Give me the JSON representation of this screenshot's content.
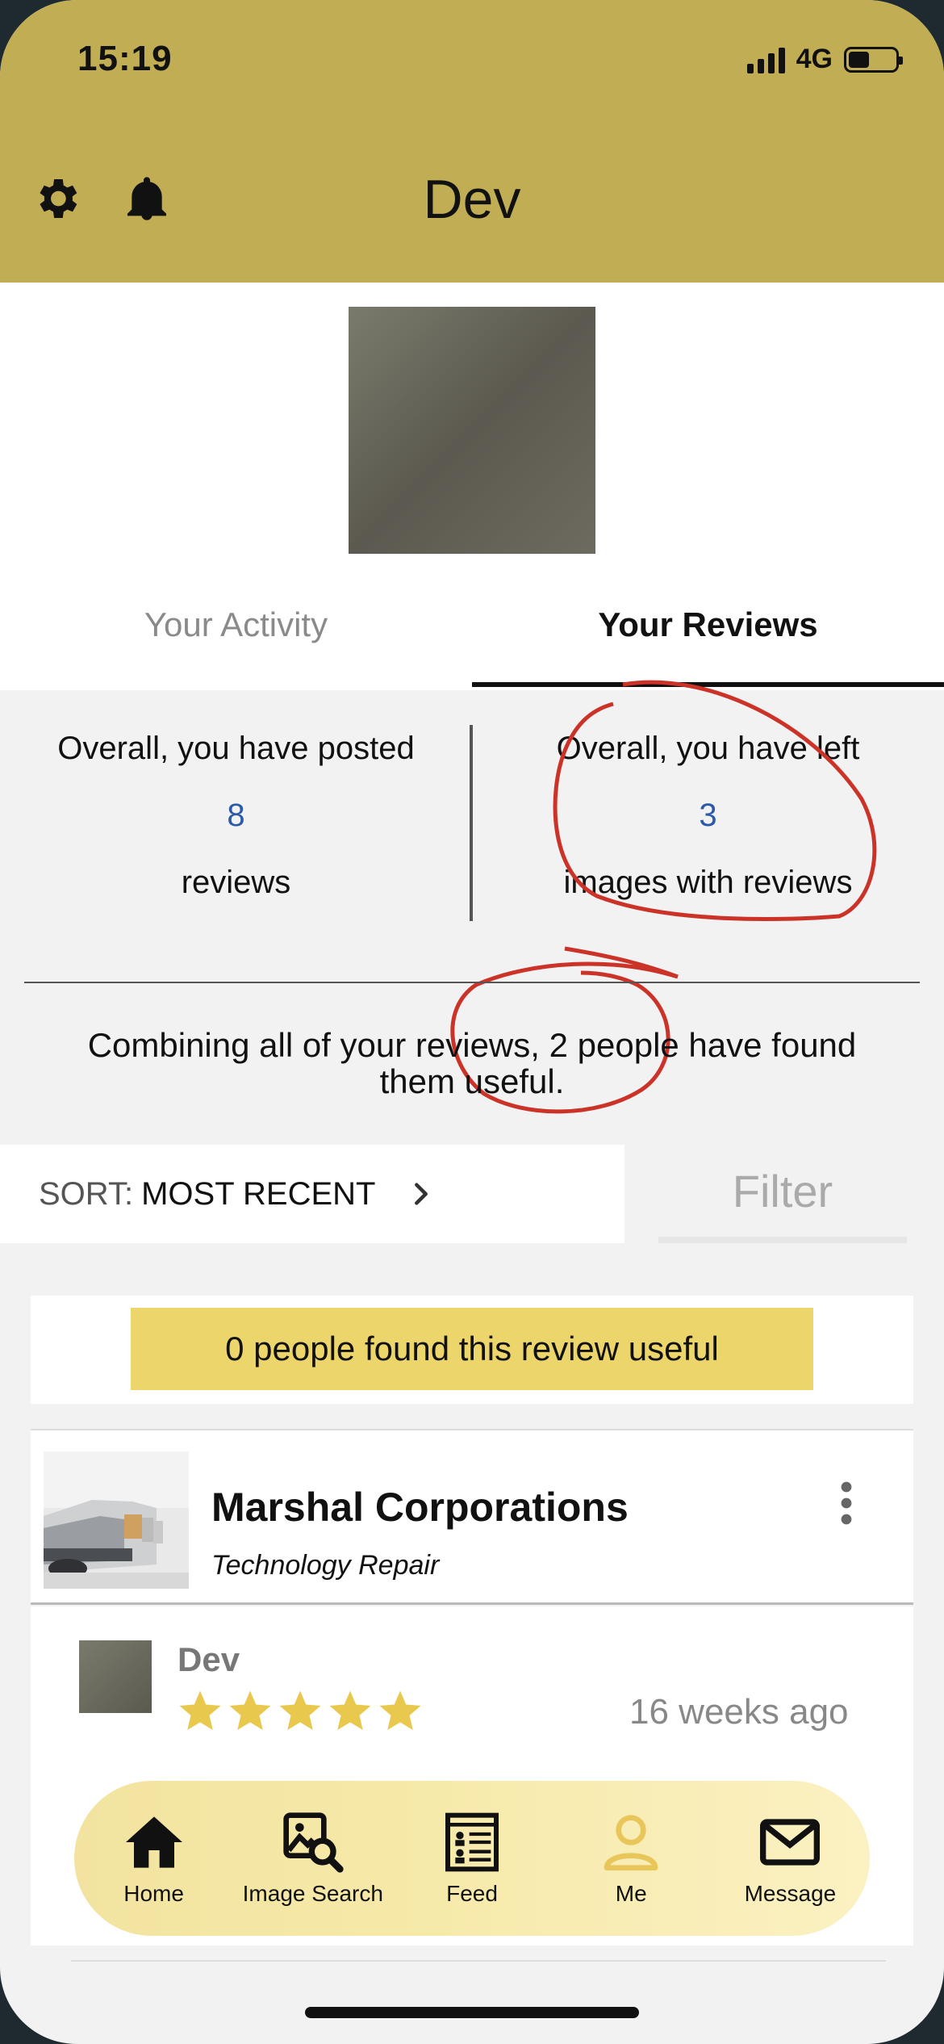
{
  "status_bar": {
    "time": "15:19",
    "network": "4G"
  },
  "header": {
    "title": "Dev"
  },
  "tabs": [
    {
      "label": "Your Activity",
      "selected": false
    },
    {
      "label": "Your Reviews",
      "selected": true
    }
  ],
  "stats": {
    "posted_prefix": "Overall, you have posted",
    "posted_count": "8",
    "posted_suffix": "reviews",
    "images_prefix": "Overall, you have left",
    "images_count": "3",
    "images_suffix": "images with reviews",
    "combined_text": "Combining all of your reviews, 2 people have found them useful."
  },
  "sort": {
    "label": "SORT:",
    "value": "MOST RECENT"
  },
  "filter": {
    "label": "Filter"
  },
  "review": {
    "useful_text": "0 people found this review useful",
    "business_name": "Marshal Corporations",
    "business_category": "Technology Repair",
    "reviewer_name": "Dev",
    "rating": 5,
    "time_ago": "16 weeks ago"
  },
  "nav": [
    {
      "label": "Home",
      "icon": "home-icon"
    },
    {
      "label": "Image Search",
      "icon": "image-search-icon"
    },
    {
      "label": "Feed",
      "icon": "feed-icon"
    },
    {
      "label": "Me",
      "icon": "person-icon"
    },
    {
      "label": "Message",
      "icon": "mail-icon"
    }
  ],
  "colors": {
    "header": "#c1ad53",
    "accent_pill": "#ecd56a",
    "link_number": "#2a5aa8",
    "active_nav": "#e8c65a"
  }
}
